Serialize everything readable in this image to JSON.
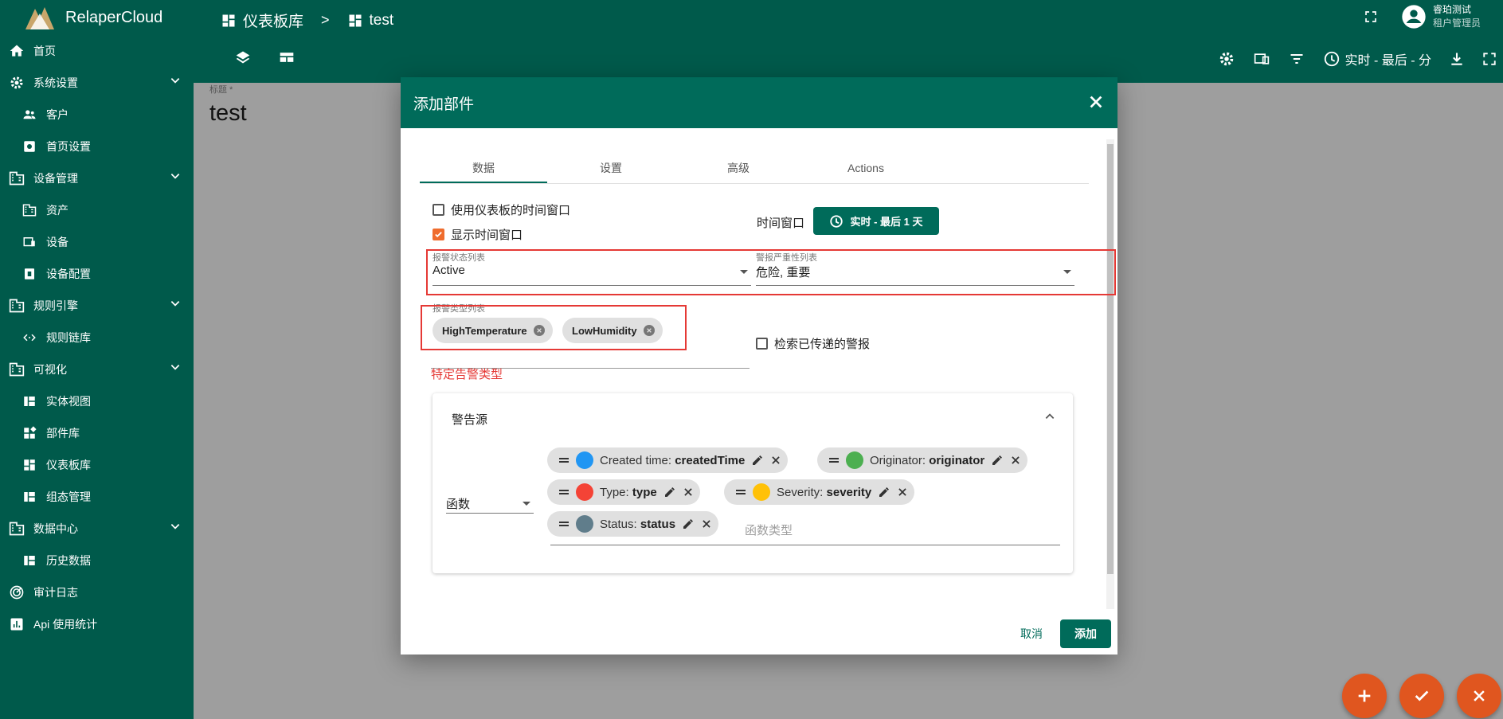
{
  "app": {
    "name": "RelaperCloud"
  },
  "sidebar": {
    "items": [
      {
        "label": "首页",
        "icon": "home-icon"
      },
      {
        "label": "系统设置",
        "icon": "gear-icon",
        "expandable": true
      },
      {
        "label": "客户",
        "icon": "people-icon"
      },
      {
        "label": "首页设置",
        "icon": "settings-box-icon"
      },
      {
        "label": "设备管理",
        "icon": "domain-icon",
        "expandable": true
      },
      {
        "label": "资产",
        "icon": "domain-icon"
      },
      {
        "label": "设备",
        "icon": "devices-icon"
      },
      {
        "label": "设备配置",
        "icon": "device-profile-icon"
      },
      {
        "label": "规则引擎",
        "icon": "domain-icon",
        "expandable": true
      },
      {
        "label": "规则链库",
        "icon": "code-icon"
      },
      {
        "label": "可视化",
        "icon": "domain-icon",
        "expandable": true
      },
      {
        "label": "实体视图",
        "icon": "view-quilt-icon"
      },
      {
        "label": "部件库",
        "icon": "widgets-icon"
      },
      {
        "label": "仪表板库",
        "icon": "dashboard-icon"
      },
      {
        "label": "组态管理",
        "icon": "view-quilt-icon"
      },
      {
        "label": "数据中心",
        "icon": "domain-icon",
        "expandable": true
      },
      {
        "label": "历史数据",
        "icon": "view-quilt-icon"
      },
      {
        "label": "审计日志",
        "icon": "track-changes-icon"
      },
      {
        "label": "Api 使用统计",
        "icon": "insert-chart-icon"
      }
    ]
  },
  "header": {
    "breadcrumb": [
      "仪表板库",
      "test"
    ],
    "breadcrumb_sep": ">",
    "user": {
      "name": "睿珀测试",
      "role": "租户管理员"
    },
    "time_window": "实时 - 最后 - 分"
  },
  "dashboard": {
    "title_label": "标题 *",
    "title": "test"
  },
  "dialog": {
    "title": "添加部件",
    "tabs": [
      "数据",
      "设置",
      "高级",
      "Actions"
    ],
    "use_dashboard_timewindow": "使用仪表板的时间窗口",
    "display_timewindow": "显示时间窗口",
    "timewindow_label": "时间窗口",
    "timewindow_value": "实时 - 最后 1 天",
    "alarm_status": {
      "label": "报警状态列表",
      "value": "Active"
    },
    "alarm_severity": {
      "label": "警报严重性列表",
      "value": "危险, 重要"
    },
    "alarm_types": {
      "label": "报警类型列表",
      "chips": [
        "HighTemperature",
        "LowHumidity"
      ]
    },
    "search_propagated": "检索已传递的警报",
    "annotation": "特定告警类型",
    "alarm_source": {
      "title": "警告源",
      "function_label": "函数",
      "keys_placeholder": "函数类型",
      "keys": [
        {
          "label": "Created time:",
          "key": "createdTime",
          "color": "#2196f3"
        },
        {
          "label": "Originator:",
          "key": "originator",
          "color": "#4caf50"
        },
        {
          "label": "Type:",
          "key": "type",
          "color": "#f44336"
        },
        {
          "label": "Severity:",
          "key": "severity",
          "color": "#ffc107"
        },
        {
          "label": "Status:",
          "key": "status",
          "color": "#607d8b"
        }
      ]
    },
    "cancel": "取消",
    "add": "添加"
  },
  "colors": {
    "primary": "#006b5a",
    "sidebar": "#005a4b",
    "accent": "#e0561f",
    "highlight": "#e53935"
  }
}
